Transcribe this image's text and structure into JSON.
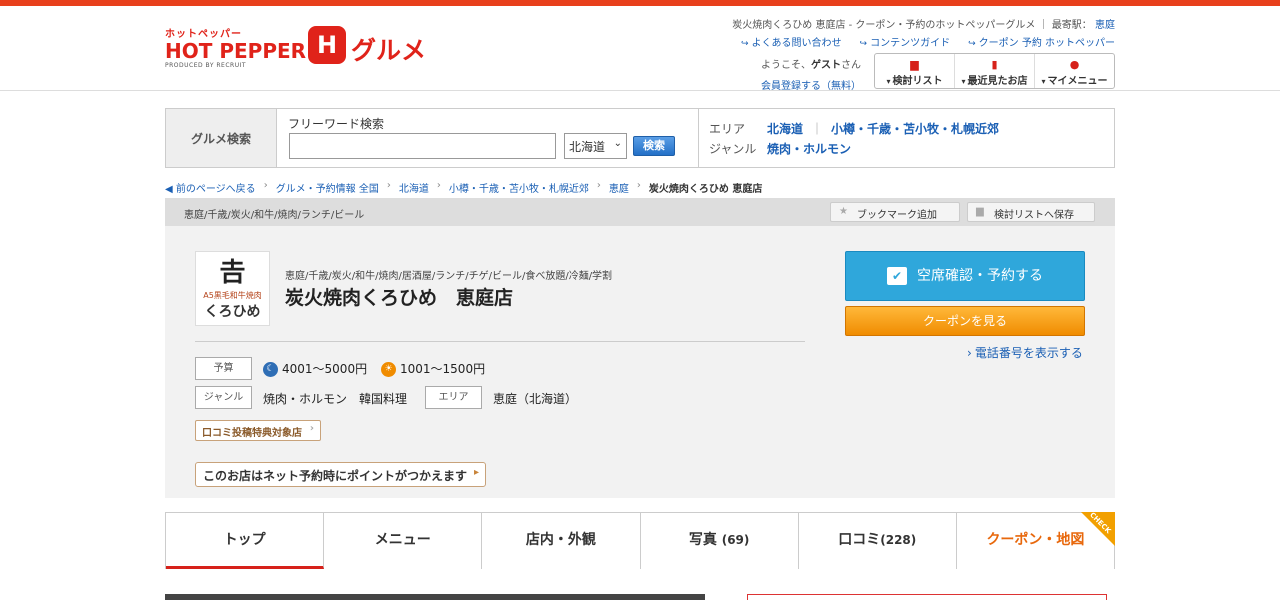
{
  "header": {
    "logo_small": "ホットペッパー",
    "logo_big": "HOT PEPPER",
    "logo_produced": "PRODUCED BY RECRUIT",
    "logo_gourmet": "グルメ",
    "tagline": "炭火焼肉くろひめ 恵庭店 - クーポン・予約のホットペッパーグルメ",
    "nearest_label": "最寄駅：",
    "nearest_station": "恵庭",
    "links": [
      "よくある問い合わせ",
      "コンテンツガイド",
      "クーポン 予約 ホットペッパー"
    ],
    "welcome_prefix": "ようこそ、",
    "welcome_name": "ゲスト",
    "welcome_suffix": "さん",
    "register": "会員登録する（無料）",
    "user_menu": [
      {
        "label": "検討リスト",
        "icon": "list-icon"
      },
      {
        "label": "最近見たお店",
        "icon": "history-icon"
      },
      {
        "label": "マイメニュー",
        "icon": "person-icon"
      }
    ]
  },
  "search": {
    "section_label": "グルメ検索",
    "freeword_label": "フリーワード検索",
    "input_value": "",
    "area_select": "北海道",
    "button": "検索",
    "area_key": "エリア",
    "area_links": [
      "北海道",
      "小樽・千歳・苫小牧・札幌近郊"
    ],
    "genre_key": "ジャンル",
    "genre_link": "焼肉・ホルモン"
  },
  "breadcrumb": {
    "back": "前のページへ戻る",
    "items": [
      "グルメ・予約情報 全国",
      "北海道",
      "小樽・千歳・苫小牧・札幌近郊",
      "恵庭"
    ],
    "current": "炭火焼肉くろひめ 恵庭店"
  },
  "shop": {
    "strip_tags": "恵庭/千歳/炭火/和牛/焼肉/ランチ/ビール",
    "bookmark": "ブックマーク追加",
    "save_list": "検討リストへ保存",
    "photo_text1": "𠮷",
    "photo_text2": "A5黒毛和牛焼肉",
    "photo_text3": "くろひめ",
    "tags": "恵庭/千歳/炭火/和牛/焼肉/居酒屋/ランチ/チゲ/ビール/食べ放題/冷麺/学割",
    "name": "炭火焼肉くろひめ　恵庭店",
    "budget_label": "予算",
    "dinner_budget": "4001～5000円",
    "lunch_budget": "1001～1500円",
    "genre_label": "ジャンル",
    "genre_value": "焼肉・ホルモン　韓国料理",
    "area_label": "エリア",
    "area_value": "恵庭（北海道）",
    "review_badge": "口コミ投稿特典対象店",
    "points_text": "このお店はネット予約時にポイントがつかえます",
    "reserve_button": "空席確認・予約する",
    "coupon_button": "クーポンを見る",
    "tel_link": "電話番号を表示する",
    "colors": {
      "reserve": "#2fa7db",
      "coupon": "#f5a316",
      "brand": "#e0231a"
    }
  },
  "tabs": [
    {
      "label": "トップ",
      "count": ""
    },
    {
      "label": "メニュー",
      "count": ""
    },
    {
      "label": "店内・外観",
      "count": ""
    },
    {
      "label": "写真",
      "count": "(69)"
    },
    {
      "label": "口コミ",
      "count": "(228)"
    },
    {
      "label": "クーポン・地図",
      "count": ""
    }
  ],
  "check_badge": "CHECK"
}
